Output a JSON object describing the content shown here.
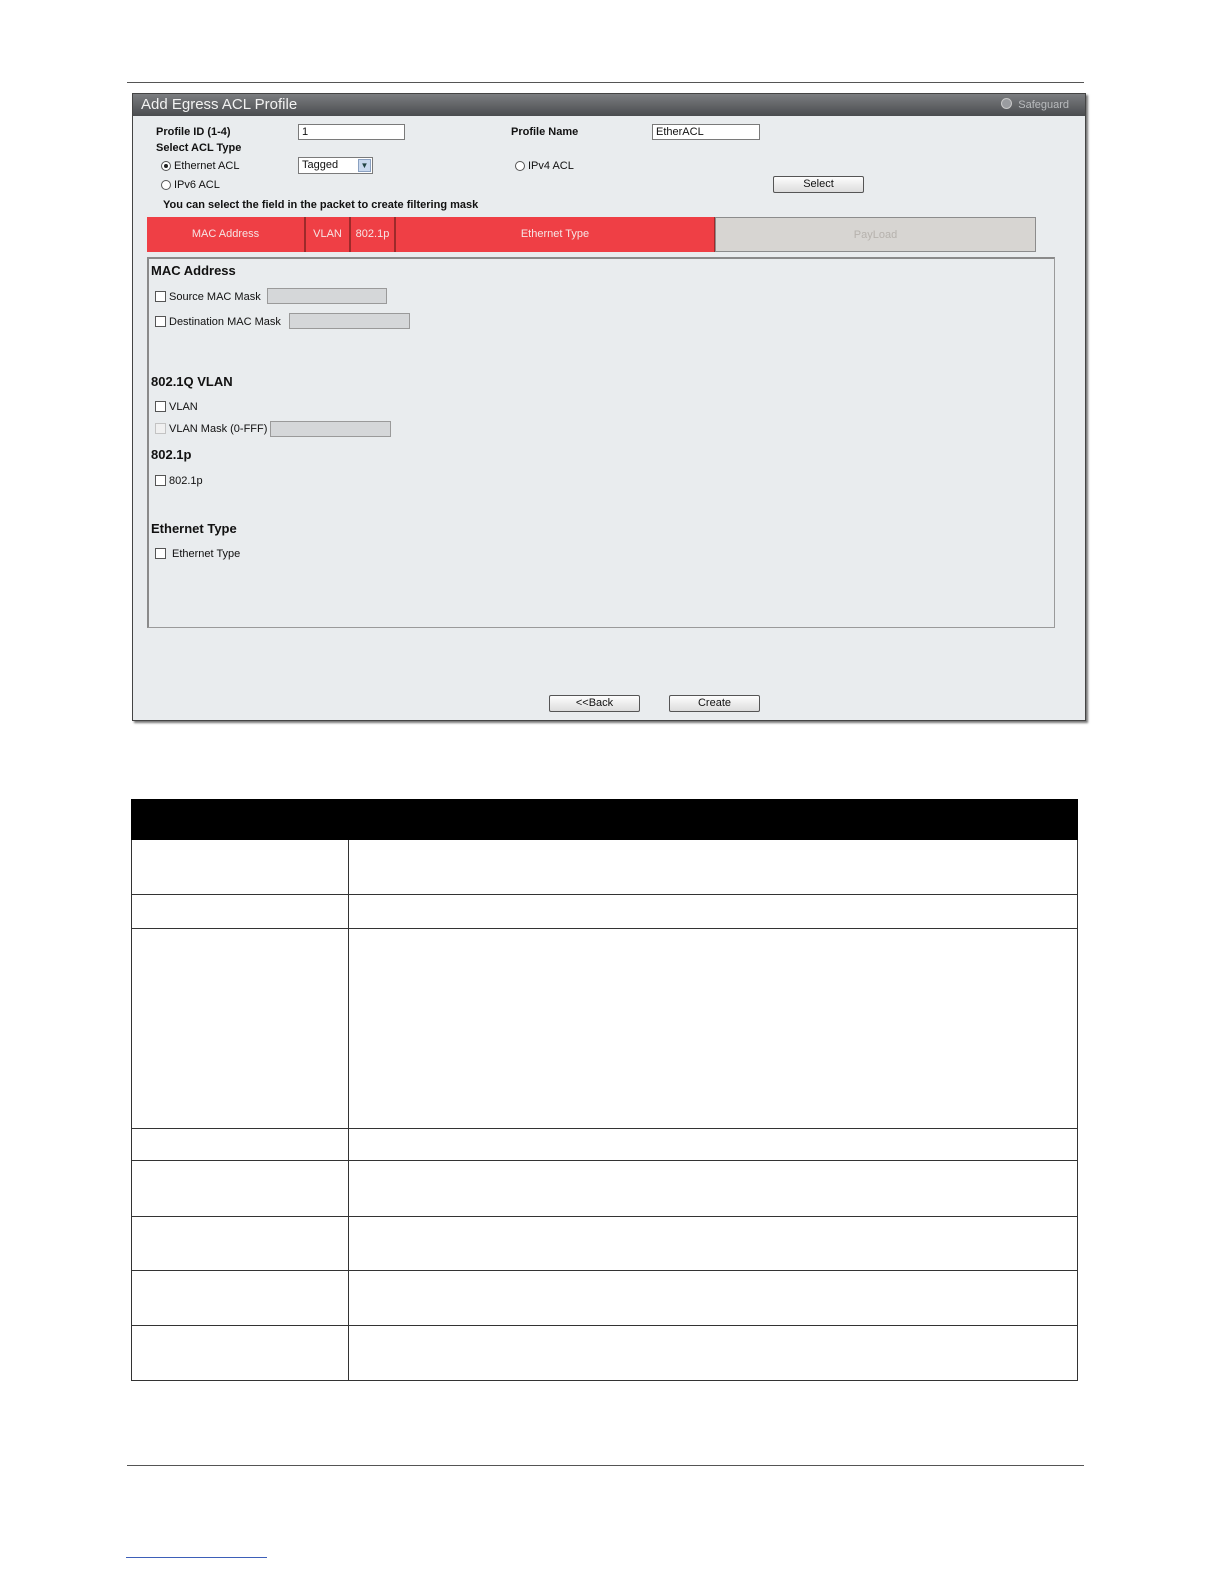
{
  "window": {
    "title": "Add Egress ACL Profile",
    "safeguard": "Safeguard"
  },
  "form": {
    "profile_id_label": "Profile ID (1-4)",
    "profile_id_value": "1",
    "profile_name_label": "Profile Name",
    "profile_name_value": "EtherACL",
    "select_acl_type_label": "Select ACL Type",
    "ethernet_acl_label": "Ethernet ACL",
    "tag_select_value": "Tagged",
    "ipv4_acl_label": "IPv4 ACL",
    "ipv6_acl_label": "IPv6 ACL",
    "select_button": "Select",
    "instruction": "You can select the field in the packet to create filtering mask"
  },
  "packet_fields": [
    {
      "label": "MAC Address",
      "state": "active"
    },
    {
      "label": "VLAN",
      "state": "active"
    },
    {
      "label": "802.1p",
      "state": "active"
    },
    {
      "label": "Ethernet Type",
      "state": "active"
    },
    {
      "label": "PayLoad",
      "state": "disabled"
    }
  ],
  "sections": {
    "mac_address": {
      "heading": "MAC Address",
      "source_mac_mask": "Source MAC Mask",
      "destination_mac_mask": "Destination MAC Mask"
    },
    "vlan": {
      "heading": "802.1Q VLAN",
      "vlan": "VLAN",
      "vlan_mask": "VLAN Mask (0-FFF)"
    },
    "dot1p": {
      "heading": "802.1p",
      "dot1p": "802.1p"
    },
    "ethernet_type": {
      "heading": "Ethernet Type",
      "ethernet_type": "Ethernet Type"
    }
  },
  "buttons": {
    "back": "<<Back",
    "create": "Create"
  },
  "colors": {
    "active_field": "#ef3f45",
    "disabled_field": "#d7d5d2",
    "window_bg": "#e9ecee",
    "table_header": "#000000"
  }
}
